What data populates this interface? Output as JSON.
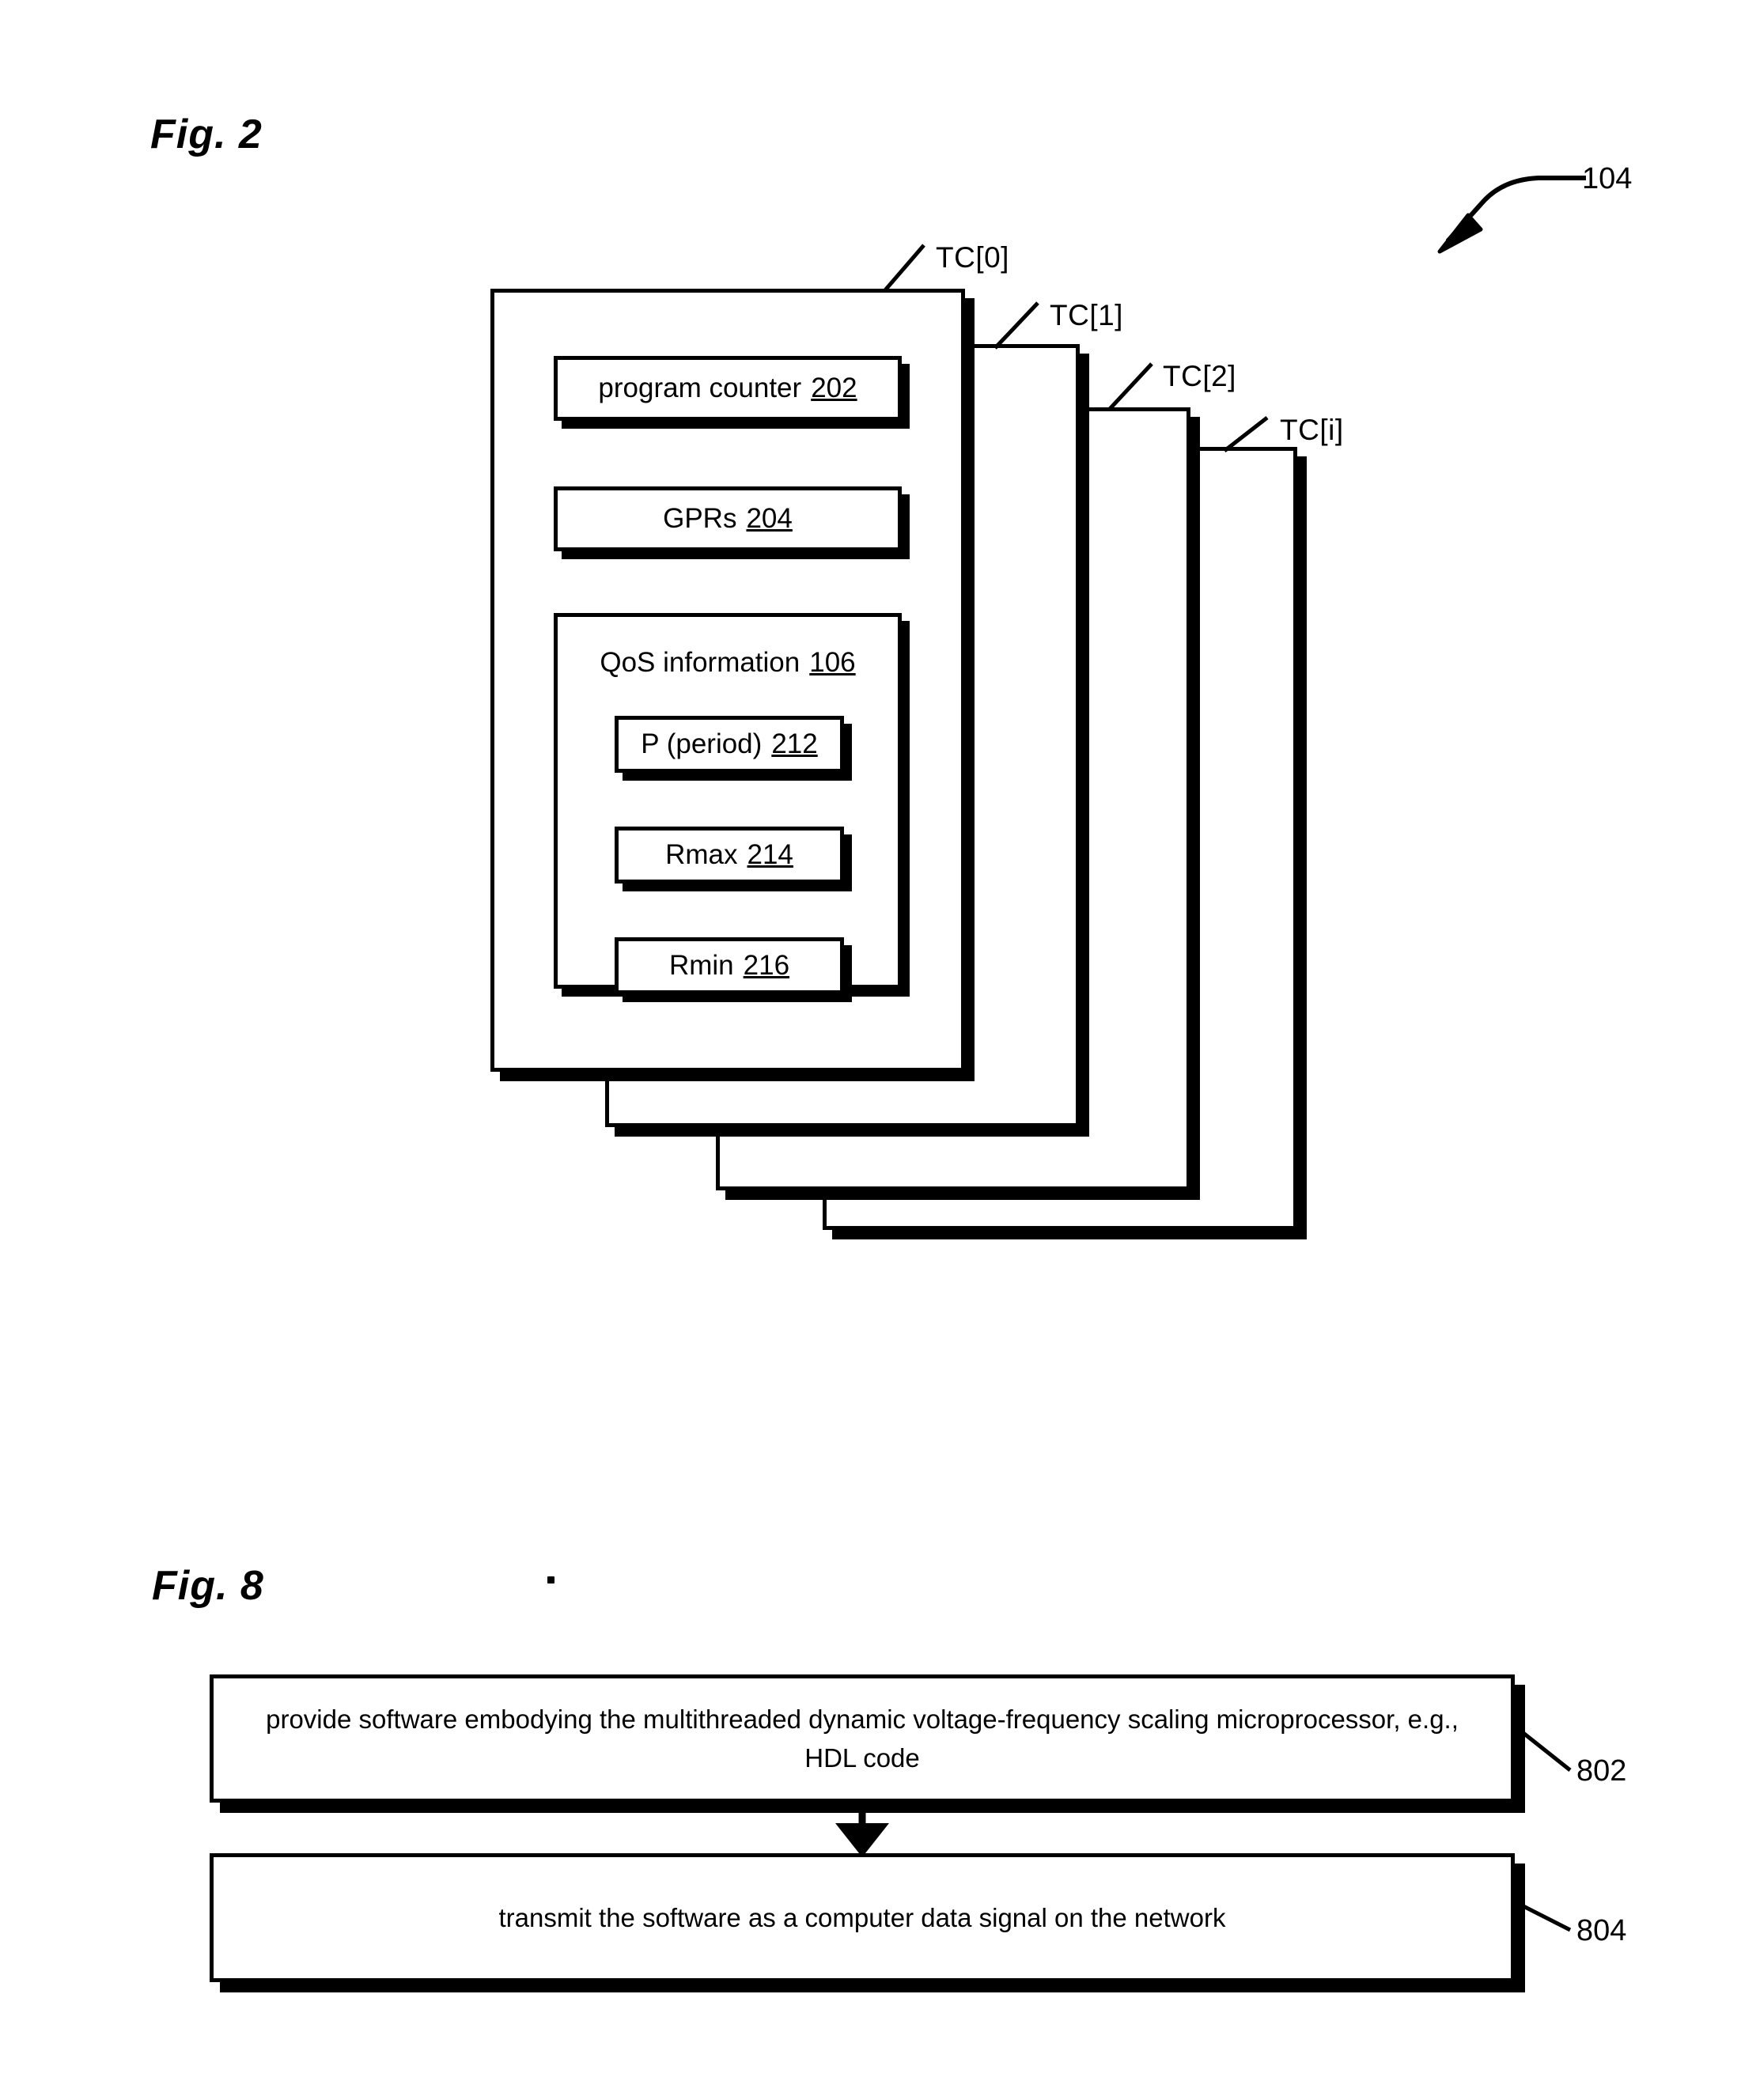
{
  "page": {
    "background": "#ffffff",
    "ink": "#000000"
  },
  "figures": [
    {
      "caption": "Fig. 2",
      "reference_numeral": "104",
      "thread_contexts": [
        {
          "label": "TC[0]"
        },
        {
          "label": "TC[1]"
        },
        {
          "label": "TC[2]"
        },
        {
          "label": "TC[i]"
        }
      ],
      "tc0_contents": {
        "program_counter": {
          "text": "program counter",
          "num": "202"
        },
        "gprs": {
          "text": "GPRs",
          "num": "204"
        },
        "qos": {
          "title_text": "QoS information",
          "title_num": "106",
          "fields": [
            {
              "text": "P (period)",
              "num": "212"
            },
            {
              "text": "Rmax",
              "num": "214"
            },
            {
              "text": "Rmin",
              "num": "216"
            }
          ]
        }
      }
    },
    {
      "caption": "Fig. 8",
      "steps": [
        {
          "text": "provide software embodying the multithreaded dynamic voltage-frequency scaling microprocessor, e.g., HDL code",
          "num": "802"
        },
        {
          "text": "transmit the software as a computer data signal on the network",
          "num": "804"
        }
      ]
    }
  ]
}
